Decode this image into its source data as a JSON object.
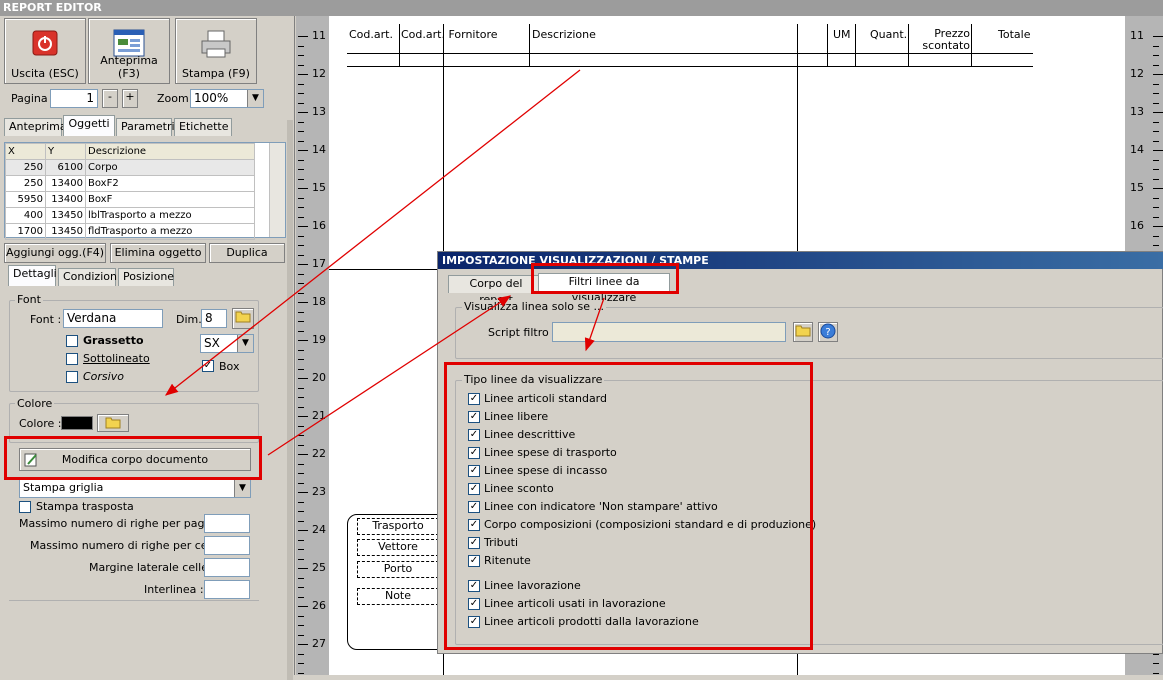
{
  "app": {
    "title": "REPORT EDITOR"
  },
  "toolbar": {
    "exit_label": "Uscita (ESC)",
    "preview_label": "Anteprima (F3)",
    "print_label": "Stampa (F9)"
  },
  "paging": {
    "page_label": "Pagina",
    "page_value": "1",
    "minus": "-",
    "plus": "+",
    "zoom_label": "Zoom",
    "zoom_value": "100%"
  },
  "tabs": {
    "preview": "Anteprima",
    "objects": "Oggetti",
    "params": "Parametri",
    "labels": "Etichette"
  },
  "grid": {
    "headers": [
      "X",
      "Y",
      "Descrizione"
    ],
    "rows": [
      [
        "250",
        "6100",
        "Corpo"
      ],
      [
        "250",
        "13400",
        "BoxF2"
      ],
      [
        "5950",
        "13400",
        "BoxF"
      ],
      [
        "400",
        "13450",
        "lblTrasporto a mezzo"
      ],
      [
        "1700",
        "13450",
        "fldTrasporto a mezzo"
      ]
    ]
  },
  "objbtns": {
    "add": "Aggiungi ogg.(F4)",
    "delete": "Elimina oggetto",
    "dup": "Duplica"
  },
  "subtabs": {
    "details": "Dettagli",
    "conditions": "Condizioni",
    "position": "Posizione"
  },
  "font": {
    "group": "Font",
    "font_label": "Font :",
    "font_value": "Verdana",
    "dim_label": "Dim.",
    "dim_value": "8",
    "bold": "Grassetto",
    "underline": "Sottolineato",
    "italic": "Corsivo",
    "align": "SX",
    "box": "Box"
  },
  "color": {
    "group": "Colore",
    "label": "Colore :",
    "value": "#000000"
  },
  "body": {
    "modify_label": "Modifica corpo documento",
    "print_grid": "Stampa griglia",
    "transposed": "Stampa trasposta",
    "max_rows_page": "Massimo numero di righe per pagina :",
    "max_rows_cell": "Massimo numero di righe per cella :",
    "margin": "Margine laterale celle :",
    "interline": "Interlinea :"
  },
  "ruler": {
    "numbers": [
      "11",
      "12",
      "13",
      "14",
      "15",
      "16",
      "17",
      "18",
      "19",
      "20",
      "21",
      "22",
      "23",
      "24",
      "25",
      "26",
      "27"
    ]
  },
  "report": {
    "headers": [
      "Cod.art.",
      "Cod.art. Fornitore",
      "Descrizione",
      "UM",
      "Quant.",
      "Prezzo scontato",
      "Totale"
    ],
    "footer": [
      "Trasporto",
      "Vettore",
      "Porto",
      "Note"
    ]
  },
  "dialog": {
    "title": "IMPOSTAZIONE VISUALIZZAZIONI / STAMPE",
    "tab_body": "Corpo del report",
    "tab_filters": "Filtri linee da visualizzare",
    "show_if": "Visualizza linea solo se ...",
    "script_label": "Script filtro :",
    "types_title": "Tipo linee da visualizzare",
    "items": [
      "Linee articoli standard",
      "Linee libere",
      "Linee descrittive",
      "Linee spese di trasporto",
      "Linee spese di incasso",
      "Linee sconto",
      "Linee con indicatore 'Non stampare' attivo",
      "Corpo composizioni (composizioni standard e di produzione)",
      "Tributi",
      "Ritenute",
      "Linee lavorazione",
      "Linee articoli usati in lavorazione",
      "Linee articoli prodotti dalla lavorazione"
    ]
  }
}
